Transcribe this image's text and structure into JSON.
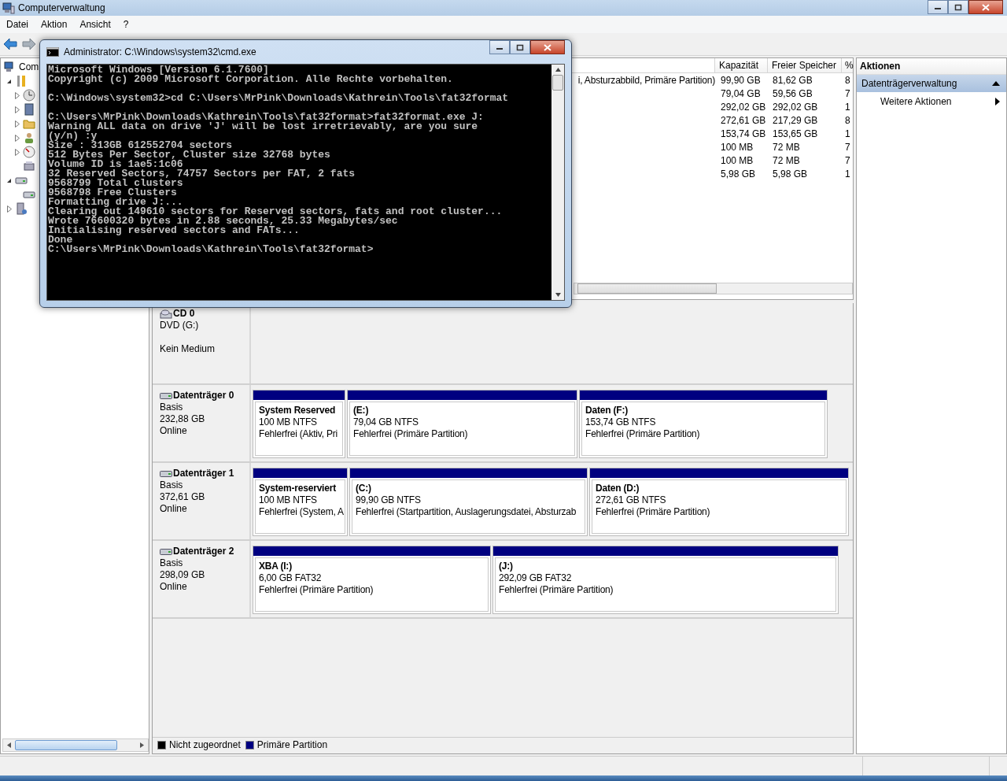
{
  "window": {
    "title": "Computerverwaltung"
  },
  "menu": [
    "Datei",
    "Aktion",
    "Ansicht",
    "?"
  ],
  "tree": [
    {
      "label": "Com",
      "kind": "computer",
      "children": [
        {
          "kind": "tools",
          "expanded": true,
          "children": [
            {
              "kind": "clock",
              "expanded": false
            },
            {
              "kind": "log",
              "expanded": false
            },
            {
              "kind": "share",
              "expanded": false
            },
            {
              "kind": "users",
              "expanded": false
            },
            {
              "kind": "gauge",
              "expanded": false
            },
            {
              "kind": "device"
            }
          ]
        },
        {
          "kind": "storage",
          "expanded": true,
          "children": [
            {
              "kind": "disk"
            }
          ]
        },
        {
          "kind": "services",
          "expanded": false
        }
      ]
    }
  ],
  "volume_table": {
    "columns": [
      "Kapazität",
      "Freier Speicher",
      "%"
    ],
    "rows": [
      {
        "column_1": "i, Absturzabbild, Primäre Partition)",
        "cells": [
          "99,90 GB",
          "81,62 GB",
          "8"
        ]
      },
      {
        "cells": [
          "79,04 GB",
          "59,56 GB",
          "7"
        ]
      },
      {
        "cells": [
          "292,02 GB",
          "292,02 GB",
          "1"
        ]
      },
      {
        "cells": [
          "272,61 GB",
          "217,29 GB",
          "8"
        ]
      },
      {
        "cells": [
          "153,74 GB",
          "153,65 GB",
          "1"
        ]
      },
      {
        "cells": [
          "100 MB",
          "72 MB",
          "7"
        ]
      },
      {
        "cells": [
          "100 MB",
          "72 MB",
          "7"
        ]
      },
      {
        "cells": [
          "5,98 GB",
          "5,98 GB",
          "1"
        ]
      }
    ]
  },
  "cd_drive": {
    "name": "CD 0",
    "type": "DVD (G:)",
    "status": "Kein Medium"
  },
  "disks": [
    {
      "name": "Datenträger 0",
      "type": "Basis",
      "size": "232,88 GB",
      "status": "Online",
      "partitions": [
        {
          "title": "System Reserved",
          "size": "100 MB NTFS",
          "health": "Fehlerfrei (Aktiv, Pri"
        },
        {
          "title": "(E:)",
          "size": "79,04 GB NTFS",
          "health": "Fehlerfrei (Primäre Partition)"
        },
        {
          "title": "Daten  (F:)",
          "size": "153,74 GB NTFS",
          "health": "Fehlerfrei (Primäre Partition)"
        }
      ]
    },
    {
      "name": "Datenträger 1",
      "type": "Basis",
      "size": "372,61 GB",
      "status": "Online",
      "partitions": [
        {
          "title": "System-reserviert",
          "size": "100 MB NTFS",
          "health": "Fehlerfrei (System, A"
        },
        {
          "title": "(C:)",
          "size": "99,90 GB NTFS",
          "health": "Fehlerfrei (Startpartition, Auslagerungsdatei, Absturzab"
        },
        {
          "title": "Daten  (D:)",
          "size": "272,61 GB NTFS",
          "health": "Fehlerfrei (Primäre Partition)"
        }
      ]
    },
    {
      "name": "Datenträger 2",
      "type": "Basis",
      "size": "298,09 GB",
      "status": "Online",
      "partitions": [
        {
          "title": "XBA  (I:)",
          "size": "6,00 GB FAT32",
          "health": "Fehlerfrei (Primäre Partition)"
        },
        {
          "title": "(J:)",
          "size": "292,09 GB FAT32",
          "health": "Fehlerfrei (Primäre Partition)"
        }
      ]
    }
  ],
  "legend": [
    {
      "label": "Nicht zugeordnet",
      "color": "#000000"
    },
    {
      "label": "Primäre Partition",
      "color": "#000080"
    }
  ],
  "actions": {
    "title": "Aktionen",
    "section": {
      "label": "Datenträgerverwaltung",
      "expanded": true
    },
    "items": [
      "Weitere Aktionen"
    ]
  },
  "console": {
    "title": "Administrator: C:\\Windows\\system32\\cmd.exe",
    "blocks": [
      [
        "Microsoft Windows [Version 6.1.7600]",
        "Copyright (c) 2009 Microsoft Corporation. Alle Rechte vorbehalten."
      ],
      [
        "C:\\Windows\\system32>cd C:\\Users\\MrPink\\Downloads\\Kathrein\\Tools\\fat32format"
      ],
      [
        "C:\\Users\\MrPink\\Downloads\\Kathrein\\Tools\\fat32format>fat32format.exe J:",
        "Warning ALL data on drive 'J' will be lost irretrievably, are you sure",
        "(y/n) :y",
        "Size : 313GB 612552704 sectors",
        "512 Bytes Per Sector, Cluster size 32768 bytes",
        "Volume ID is 1ae5:1c06",
        "32 Reserved Sectors, 74757 Sectors per FAT, 2 fats",
        "9568799 Total clusters",
        "9568798 Free Clusters",
        "Formatting drive J:...",
        "Clearing out 149610 sectors for Reserved sectors, fats and root cluster...",
        "Wrote 76600320 bytes in 2.88 seconds, 25.33 Megabytes/sec",
        "Initialising reserved sectors and FATs...",
        "Done",
        "C:\\Users\\MrPink\\Downloads\\Kathrein\\Tools\\fat32format>"
      ]
    ]
  }
}
